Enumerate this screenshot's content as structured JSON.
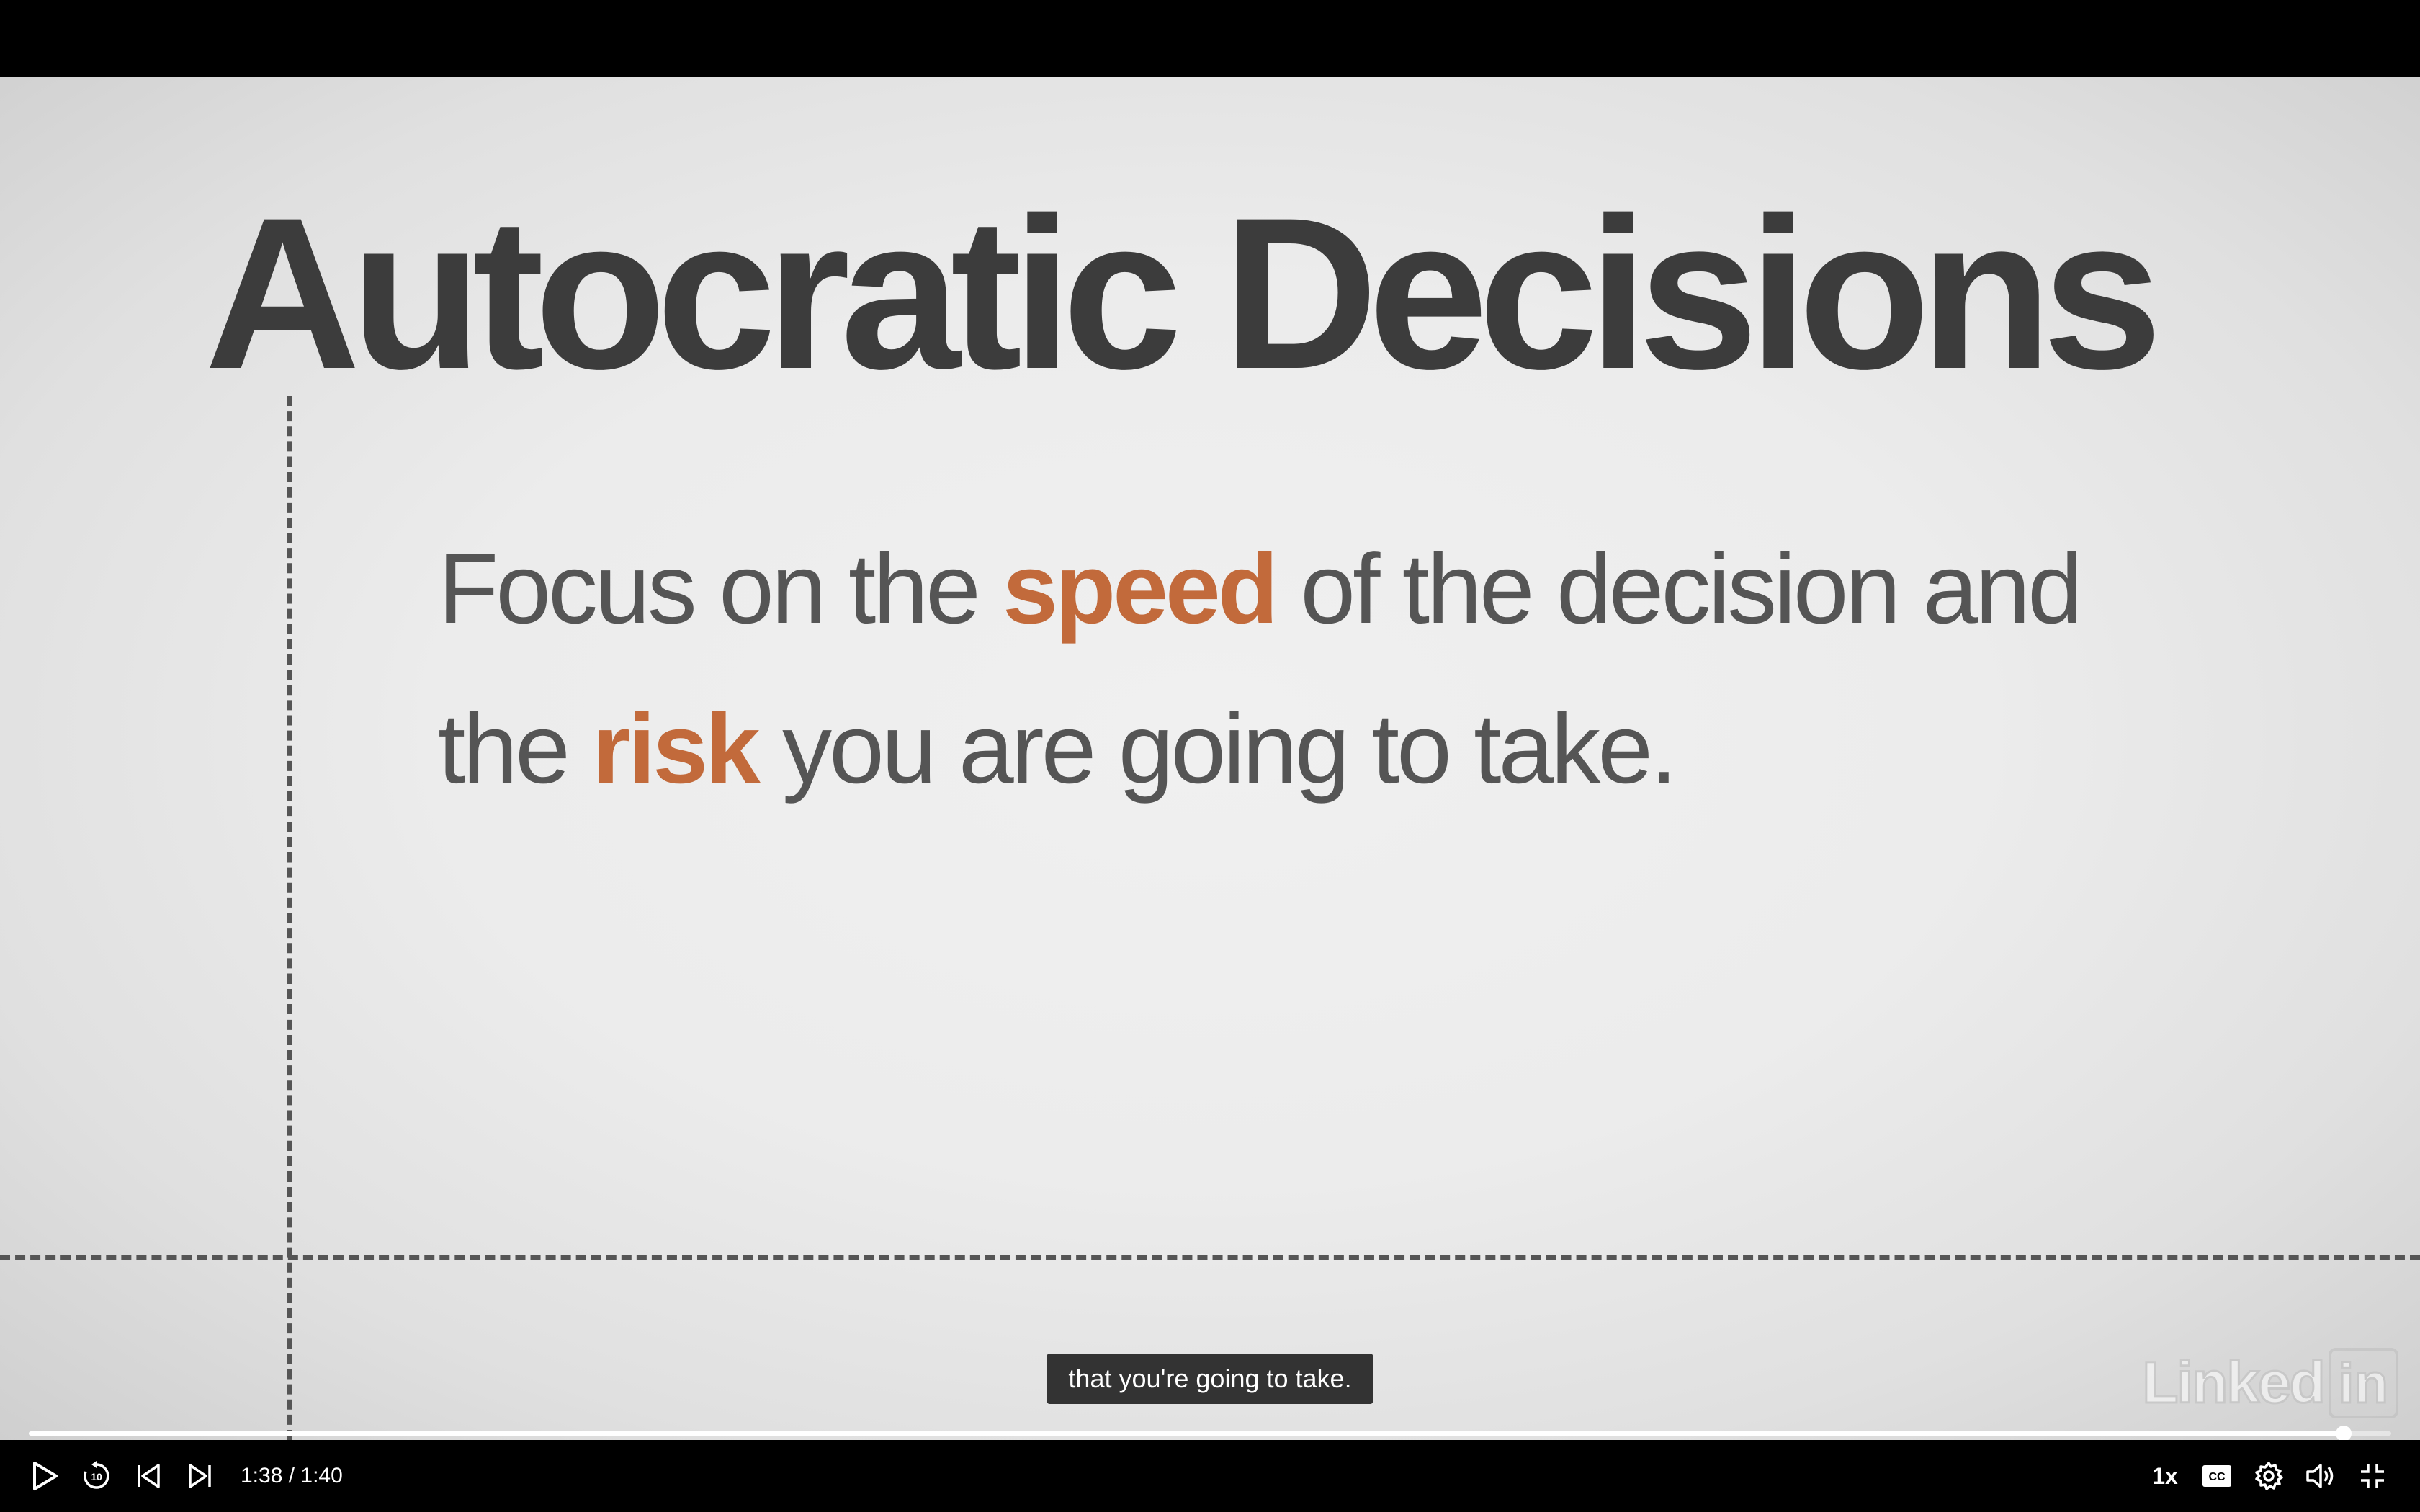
{
  "slide": {
    "title": "Autocratic Decisions",
    "body_part1": "Focus on the ",
    "accent1": "speed",
    "body_part2": " of the decision and the ",
    "accent2": "risk",
    "body_part3": " you are going to take.",
    "accent_color": "#c26a3b"
  },
  "watermark": {
    "text": "Linked",
    "box_text": "in"
  },
  "caption": {
    "text": "that you're going to take."
  },
  "player": {
    "time": "1:38 / 1:40",
    "progress_fraction": 0.98,
    "speed": "1x",
    "icons": {
      "play": "play-icon",
      "skip_back": "replay-10-icon",
      "previous": "previous-icon",
      "next": "next-icon",
      "captions": "closed-captions-icon",
      "settings": "gear-icon",
      "volume": "volume-icon",
      "fullscreen": "exit-fullscreen-icon"
    }
  }
}
